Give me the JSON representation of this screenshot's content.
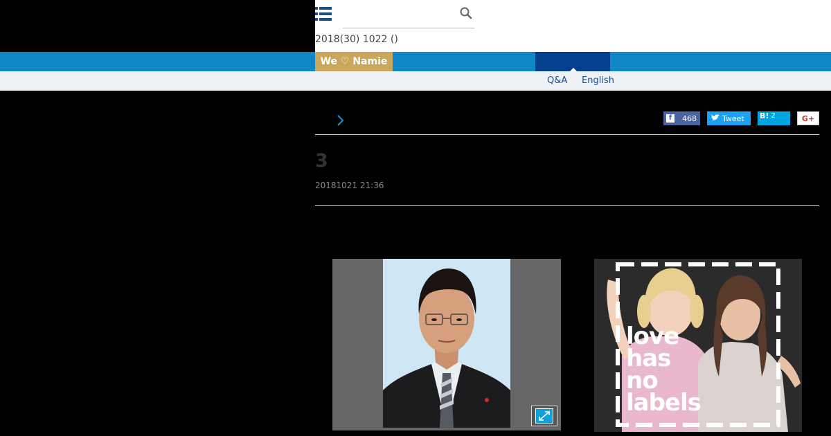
{
  "header": {
    "search_placeholder": "",
    "date_line": "2018(30) 1022 ()"
  },
  "nav": {
    "we_namie": "We ♡ Namie"
  },
  "subnav": {
    "qa": "Q&A",
    "english": "English"
  },
  "share": {
    "facebook_count": "468",
    "tweet_label": "Tweet",
    "hatena_mark": "B!",
    "hatena_count": "2",
    "gplus_label": "G+"
  },
  "article": {
    "title": "3",
    "date": "20181021 21:36"
  },
  "ad": {
    "line1": "love",
    "line2": "has",
    "line3": "no",
    "line4": "labels"
  },
  "colors": {
    "nav_blue": "#0f86c6",
    "nav_active": "#053f8e",
    "we_namie_gold": "#c9a75c",
    "facebook": "#4a64a0",
    "twitter": "#1da1f2",
    "hatena": "#00a4de"
  },
  "icons": {
    "menu": "hamburger-menu-icon",
    "search": "search-icon",
    "chevron": "chevron-right-icon",
    "expand": "expand-icon"
  }
}
